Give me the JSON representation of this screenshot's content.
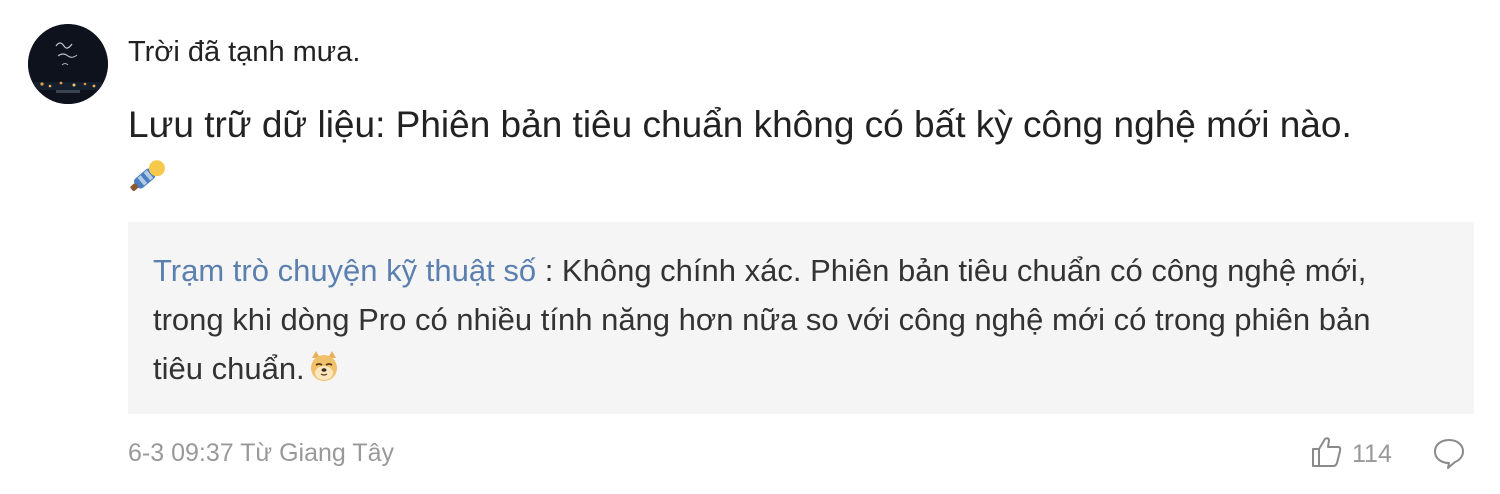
{
  "comment": {
    "username": "Trời đã tạnh mưa.",
    "text": "Lưu trữ dữ liệu: Phiên bản tiêu chuẩn không có bất kỳ công nghệ mới nào.",
    "emoji": "strong-emoji",
    "reply": {
      "author": "Trạm trò chuyện kỹ thuật số",
      "separator": " : ",
      "text": "Không chính xác. Phiên bản tiêu chuẩn có công nghệ mới, trong khi dòng Pro có nhiều tính năng hơn nữa so với công nghệ mới có trong phiên bản tiêu chuẩn.",
      "emoji": "doge-emoji"
    },
    "meta": "6-3 09:37 Từ Giang Tây",
    "likes": "114",
    "colors": {
      "author_link": "#5b7fae",
      "meta_gray": "#999999",
      "reply_bg": "#f5f5f5"
    }
  }
}
